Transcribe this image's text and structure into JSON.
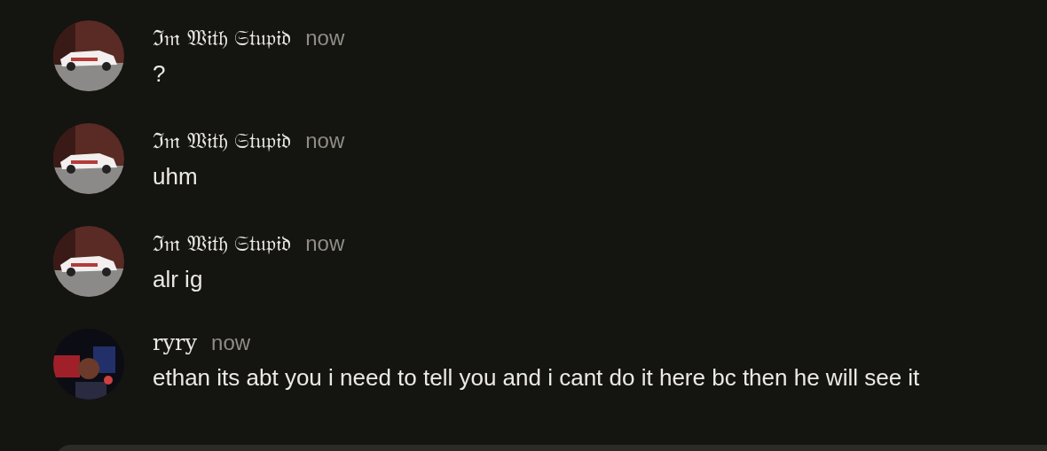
{
  "messages": [
    {
      "author": "ℑ𝔪 𝔚𝔦𝔱𝔥 𝔖𝔱𝔲𝔭𝔦𝔡",
      "time": "now",
      "text": "?"
    },
    {
      "author": "ℑ𝔪 𝔚𝔦𝔱𝔥 𝔖𝔱𝔲𝔭𝔦𝔡",
      "time": "now",
      "text": "uhm"
    },
    {
      "author": "ℑ𝔪 𝔚𝔦𝔱𝔥 𝔖𝔱𝔲𝔭𝔦𝔡",
      "time": "now",
      "text": "alr ig"
    },
    {
      "author": "ryry",
      "time": "now",
      "text": "ethan its abt you i need to tell you and i cant do it here bc then he will see it"
    }
  ]
}
